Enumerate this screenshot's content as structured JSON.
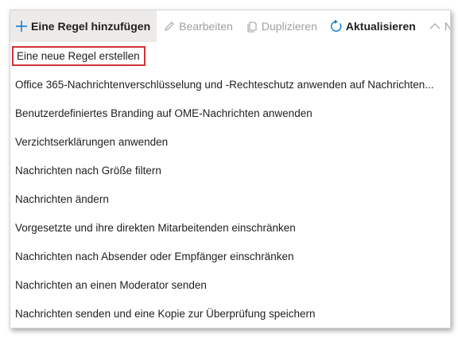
{
  "toolbar": {
    "add_rule": "Eine Regel hinzufügen",
    "edit": "Bearbeiten",
    "duplicate": "Duplizieren",
    "refresh": "Aktualisieren",
    "next": "Na"
  },
  "menu": {
    "items": [
      "Eine neue Regel erstellen",
      "Office 365-Nachrichtenverschlüsselung und -Rechteschutz anwenden auf Nachrichten...",
      "Benutzerdefiniertes Branding auf OME-Nachrichten anwenden",
      "Verzichtserklärungen anwenden",
      "Nachrichten nach Größe filtern",
      "Nachrichten ändern",
      "Vorgesetzte und ihre direkten Mitarbeitenden einschränken",
      "Nachrichten nach Absender oder Empfänger einschränken",
      "Nachrichten an einen Moderator senden",
      "Nachrichten senden und eine Kopie zur Überprüfung speichern"
    ]
  },
  "colors": {
    "accent": "#0078d4",
    "highlight_border": "#d13438",
    "disabled": "#a19f9d"
  },
  "icons": [
    "plus-icon",
    "pencil-icon",
    "duplicate-icon",
    "refresh-icon",
    "chevron-up-icon"
  ]
}
